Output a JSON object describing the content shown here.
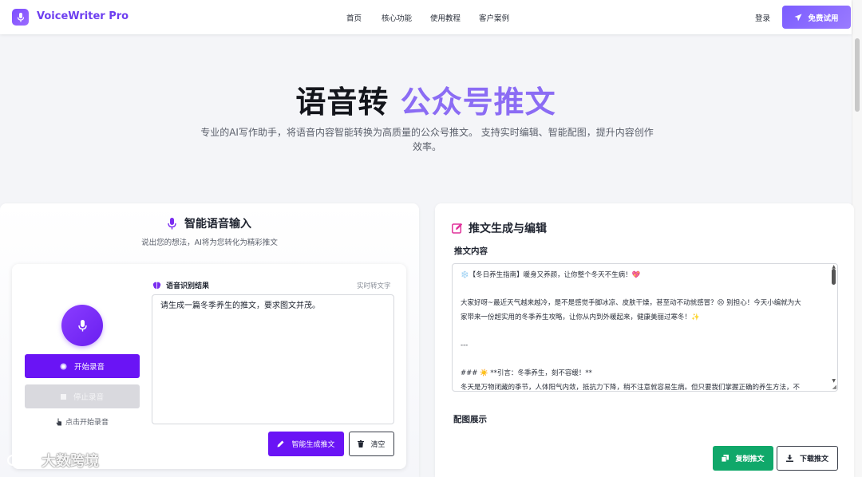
{
  "header": {
    "brand": "VoiceWriter Pro",
    "nav": [
      "首页",
      "核心功能",
      "使用教程",
      "客户案例"
    ],
    "login": "登录",
    "trial_button": "免费试用"
  },
  "hero": {
    "title_plain": "语音转 ",
    "title_accent": "公众号推文",
    "subtitle": "专业的AI写作助手，将语音内容智能转换为高质量的公众号推文。 支持实时编辑、智能配图，提升内容创作效率。"
  },
  "voice_panel": {
    "title": "智能语音输入",
    "subtitle": "说出您的想法，AI将为您转化为精彩推文",
    "start_button": "开始录音",
    "stop_button": "停止录音",
    "hint": "点击开始录音",
    "result_label": "语音识别结果",
    "result_tag": "实时转文字",
    "result_text": "请生成一篇冬季养生的推文，要求图文并茂。",
    "generate_button": "智能生成推文",
    "clear_button": "清空"
  },
  "editor_panel": {
    "title": "推文生成与编辑",
    "content_label": "推文内容",
    "article_lines": [
      "❄️【冬日养生指南】暖身又养颜，让你整个冬天不生病！💖",
      "",
      "大家好呀~最近天气越来越冷，是不是感觉手脚冰凉、皮肤干燥，甚至动不动就感冒？😣 别担心！今天小编就为大",
      "家带来一份超实用的冬季养生攻略，让你从内到外暖起来，健康美丽过寒冬！✨",
      "",
      "---",
      "",
      "### ☀️ **引言：冬季养生，刻不容缓！**",
      "冬天是万物闭藏的季节，人体阳气内敛，抵抗力下降，稍不注意就容易生病。但只要我们掌握正确的养生方法，不"
    ],
    "image_label": "配图展示",
    "copy_button": "复制推文",
    "download_button": "下载推文"
  },
  "watermark": "大数跨境"
}
